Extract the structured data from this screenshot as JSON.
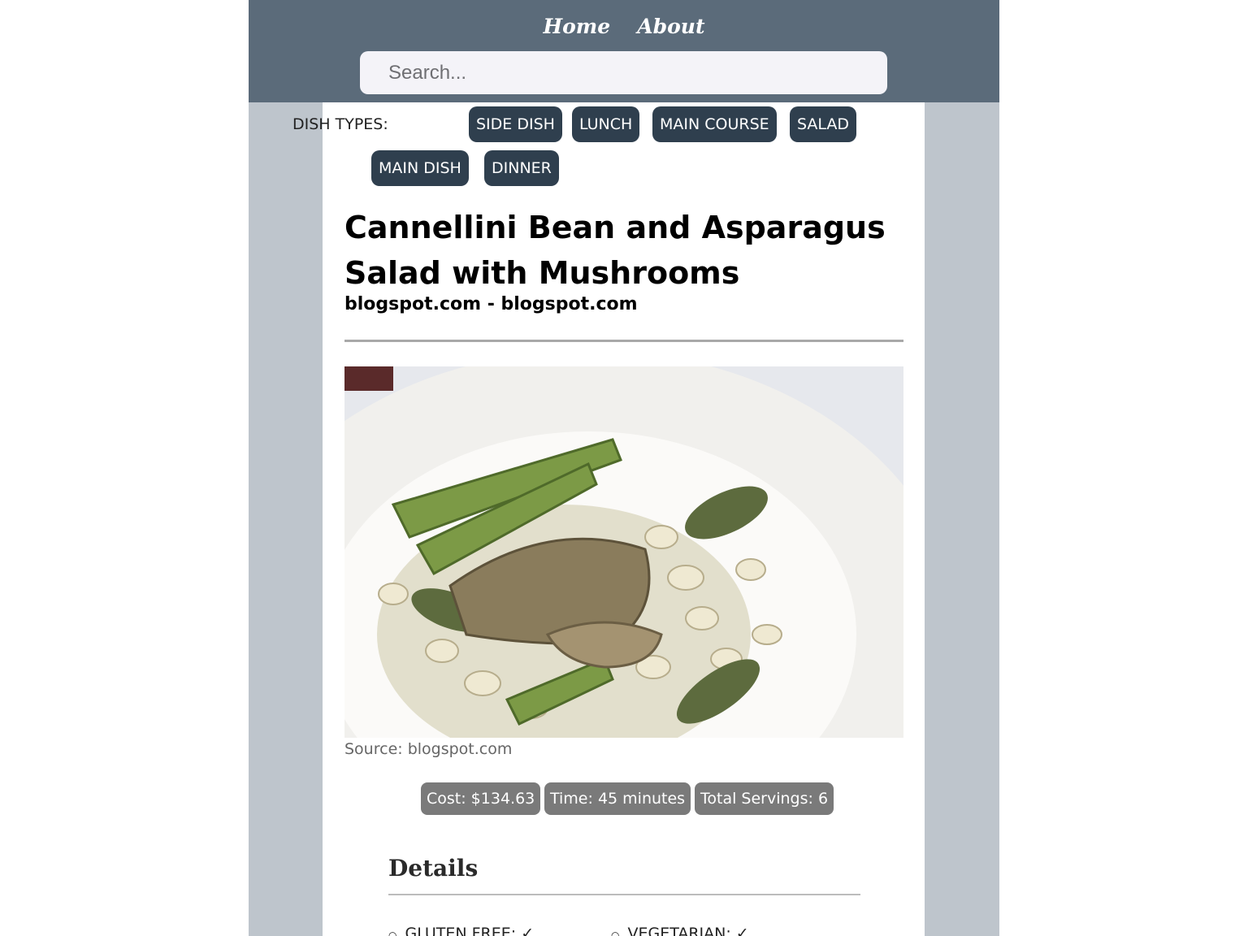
{
  "nav": {
    "home_label": "Home",
    "about_label": "About",
    "search_placeholder": "Search..."
  },
  "dish_types": {
    "label": "DISH TYPES:",
    "chips": [
      "SIDE DISH",
      "LUNCH",
      "MAIN COURSE",
      "SALAD",
      "MAIN DISH",
      "DINNER"
    ]
  },
  "recipe": {
    "title": "Cannellini Bean and Asparagus Salad with Mushrooms",
    "subtitle": "blogspot.com - blogspot.com",
    "image_caption": "Source: blogspot.com",
    "stats": {
      "cost": "Cost: $134.63",
      "time": "Time: 45 minutes",
      "servings": "Total Servings: 6"
    }
  },
  "details": {
    "heading": "Details",
    "items": [
      "GLUTEN FREE: ✓",
      "VEGETARIAN: ✓"
    ]
  },
  "colors": {
    "navbar": "#5b6b7a",
    "chip": "#2f3f4e",
    "pill": "#7a7a7a",
    "side_background": "#bec5cc"
  }
}
